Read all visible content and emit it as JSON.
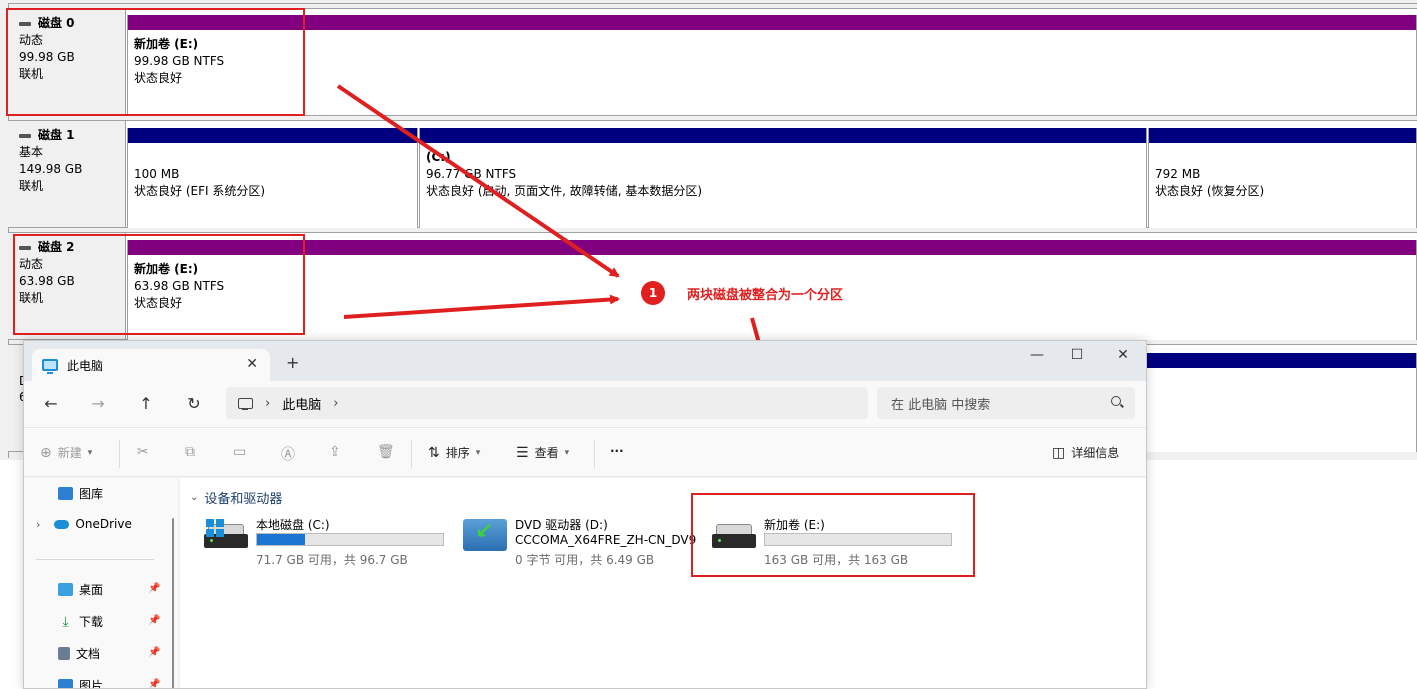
{
  "disk_management": {
    "disks": [
      {
        "name": "磁盘 0",
        "type": "动态",
        "size": "99.98 GB",
        "status": "联机",
        "partitions": [
          {
            "title": "新加卷 (E:)",
            "size": "99.98 GB NTFS",
            "status": "状态良好",
            "color": "#800080"
          }
        ]
      },
      {
        "name": "磁盘 1",
        "type": "基本",
        "size": "149.98 GB",
        "status": "联机",
        "partitions": [
          {
            "title": "",
            "size": "100 MB",
            "status": "状态良好 (EFI 系统分区)",
            "color": "#00007f"
          },
          {
            "title": "(C:)",
            "size": "96.77 GB NTFS",
            "status": "状态良好 (启动, 页面文件, 故障转储, 基本数据分区)",
            "color": "#00007f"
          },
          {
            "title": "",
            "size": "792 MB",
            "status": "状态良好 (恢复分区)",
            "color": "#00007f"
          }
        ]
      },
      {
        "name": "磁盘 2",
        "type": "动态",
        "size": "63.98 GB",
        "status": "联机",
        "partitions": [
          {
            "title": "新加卷 (E:)",
            "size": "63.98 GB NTFS",
            "status": "状态良好",
            "color": "#800080"
          }
        ]
      }
    ],
    "partial_row_letters": [
      "D",
      "6"
    ]
  },
  "annotation": {
    "number": "1",
    "text": "两块磁盘被整合为一个分区",
    "color": "#e02020"
  },
  "explorer": {
    "tab_title": "此电脑",
    "new_tab_label": "+",
    "window_controls": {
      "minimize": "—",
      "maximize": "☐",
      "close": "✕"
    },
    "address": {
      "location": "此电脑"
    },
    "search_placeholder": "在 此电脑 中搜索",
    "toolbar": {
      "new_label": "新建",
      "sort_label": "排序",
      "view_label": "查看",
      "more_label": "···",
      "details_label": "详细信息"
    },
    "sidebar": [
      {
        "label": "图库",
        "icon": "gallery-icon"
      },
      {
        "label": "OneDrive",
        "icon": "onedrive-icon"
      },
      {
        "label": "桌面",
        "icon": "desktop-icon"
      },
      {
        "label": "下载",
        "icon": "download-icon"
      },
      {
        "label": "文档",
        "icon": "documents-icon"
      },
      {
        "label": "图片",
        "icon": "pictures-icon"
      }
    ],
    "section_title": "设备和驱动器",
    "drives": [
      {
        "name": "本地磁盘 (C:)",
        "detail": "71.7 GB 可用，共 96.7 GB",
        "used_fraction": 0.26
      },
      {
        "name": "DVD 驱动器 (D:)",
        "label": "CCCOMA_X64FRE_ZH-CN_DV9",
        "detail": "0 字节 可用，共 6.49 GB"
      },
      {
        "name": "新加卷 (E:)",
        "detail": "163 GB 可用，共 163 GB",
        "used_fraction": 0.0
      }
    ]
  }
}
